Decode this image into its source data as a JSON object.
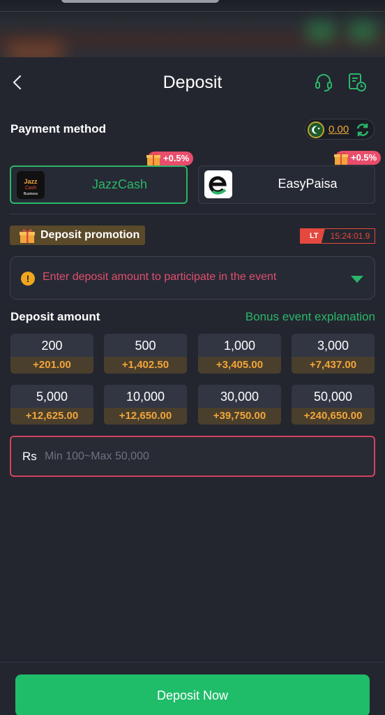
{
  "header": {
    "title": "Deposit"
  },
  "payment_method": {
    "label": "Payment method",
    "balance": "0.00",
    "methods": [
      {
        "name": "JazzCash",
        "bonus": "+0.5%",
        "selected": true
      },
      {
        "name": "EasyPaisa",
        "bonus": "+0.5%",
        "selected": false
      }
    ]
  },
  "promotion": {
    "label": "Deposit promotion",
    "timer_badge": "LT",
    "timer": "15:24:01.9",
    "event_text": "Enter deposit amount to participate in the event"
  },
  "deposit_amount": {
    "label": "Deposit amount",
    "bonus_link": "Bonus event explanation",
    "options": [
      {
        "amount": "200",
        "bonus": "+201.00"
      },
      {
        "amount": "500",
        "bonus": "+1,402.50"
      },
      {
        "amount": "1,000",
        "bonus": "+3,405.00"
      },
      {
        "amount": "3,000",
        "bonus": "+7,437.00"
      },
      {
        "amount": "5,000",
        "bonus": "+12,625.00"
      },
      {
        "amount": "10,000",
        "bonus": "+12,650.00"
      },
      {
        "amount": "30,000",
        "bonus": "+39,750.00"
      },
      {
        "amount": "50,000",
        "bonus": "+240,650.00"
      }
    ],
    "currency": "Rs",
    "placeholder": "Min 100~Max 50,000"
  },
  "footer": {
    "button_label": "Deposit Now"
  },
  "colors": {
    "accent": "#1fbc6a",
    "bonus": "#f2a53a",
    "alert": "#e14e6d",
    "background": "#23262f"
  }
}
